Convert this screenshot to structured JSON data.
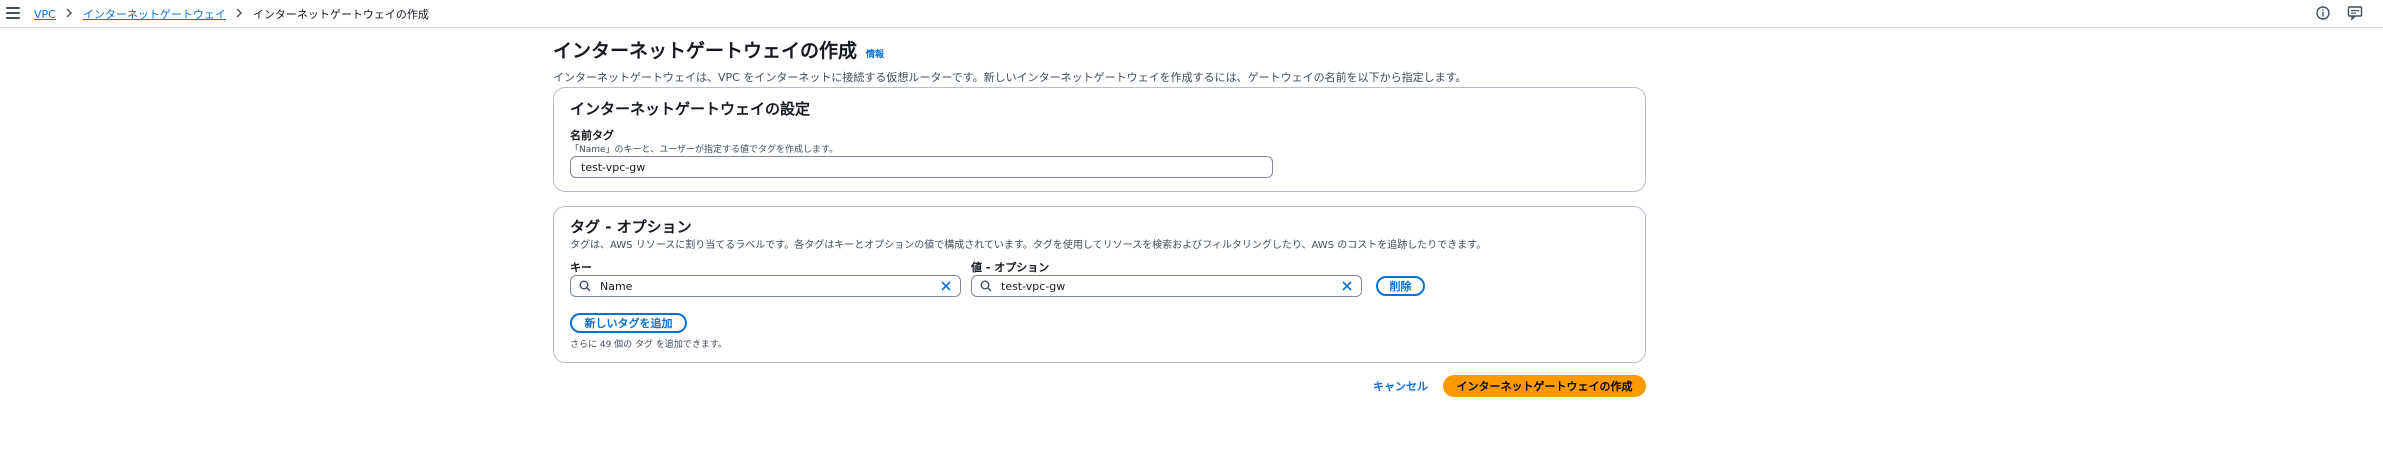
{
  "breadcrumb": {
    "items": [
      "VPC",
      "インターネットゲートウェイ"
    ],
    "current": "インターネットゲートウェイの作成"
  },
  "header": {
    "title": "インターネットゲートウェイの作成",
    "info": "情報",
    "description": "インターネットゲートウェイは、VPC をインターネットに接続する仮想ルーターです。新しいインターネットゲートウェイを作成するには、ゲートウェイの名前を以下から指定します。"
  },
  "settings": {
    "title": "インターネットゲートウェイの設定",
    "name_label": "名前タグ",
    "name_hint": "「Name」のキーと、ユーザーが指定する値でタグを作成します。",
    "name_value": "test-vpc-gw"
  },
  "tags": {
    "title": "タグ - オプション",
    "description": "タグは、AWS リソースに割り当てるラベルです。各タグはキーとオプションの値で構成されています。タグを使用してリソースを検索およびフィルタリングしたり、AWS のコストを追跡したりできます。",
    "key_label": "キー",
    "value_label": "値 - オプション",
    "key_value": "Name",
    "value_value": "test-vpc-gw",
    "remove_label": "削除",
    "add_label": "新しいタグを追加",
    "remaining_note": "さらに 49 個の タグ を追加できます。"
  },
  "footer": {
    "cancel_label": "キャンセル",
    "submit_label": "インターネットゲートウェイの作成"
  },
  "colors": {
    "link": "#0972d3",
    "primary_button": "#ff9900",
    "border": "#b6bec9"
  },
  "icons": [
    "menu-icon",
    "chevron-right-icon",
    "info-circle-icon",
    "feedback-icon",
    "search-icon",
    "close-icon"
  ]
}
